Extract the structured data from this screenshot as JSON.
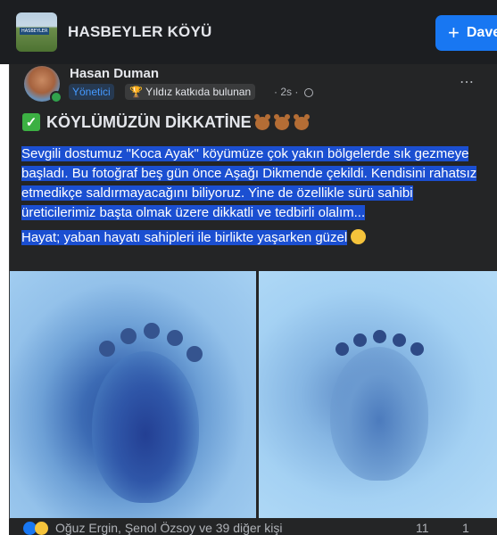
{
  "group": {
    "name": "HASBEYLER KÖYÜ",
    "thumbnail_tag": "HASBEYLER",
    "join_label": "Dave"
  },
  "post": {
    "author": "Hasan Duman",
    "role_badge": "Yönetici",
    "star_badge": "Yıldız katkıda bulunan",
    "time": "· 2s ·",
    "menu_icon": "⋯",
    "title": "KÖYLÜMÜZÜN DİKKATİNE",
    "paragraph1": "Sevgili dostumuz \"Koca Ayak\" köyümüze çok yakın bölgelerde sık gezmeye başladı. Bu fotoğraf beş gün önce Aşağı Dikmende çekildi. Kendisini rahatsız etmedikçe saldırmayacağını biliyoruz. Yine de özellikle sürü sahibi üreticilerimiz başta olmak üzere dikkatli ve tedbirli olalım...",
    "paragraph2": "Hayat; yaban hayatı sahipleri ile birlikte yaşarken güzel",
    "highlight_color": "#1b4fd1",
    "photos": [
      "bear-footprint-snow-left",
      "bear-footprint-snow-right"
    ]
  },
  "reactions": {
    "names": "Oğuz Ergin, Şenol Özsoy ve 39 diğer kişi",
    "comments": "11",
    "shares": "1"
  },
  "icons": {
    "check": "check-icon",
    "bear": "bear-face-icon",
    "smile": "smiling-face-icon",
    "globe": "globe-icon",
    "star": "trophy-icon"
  }
}
